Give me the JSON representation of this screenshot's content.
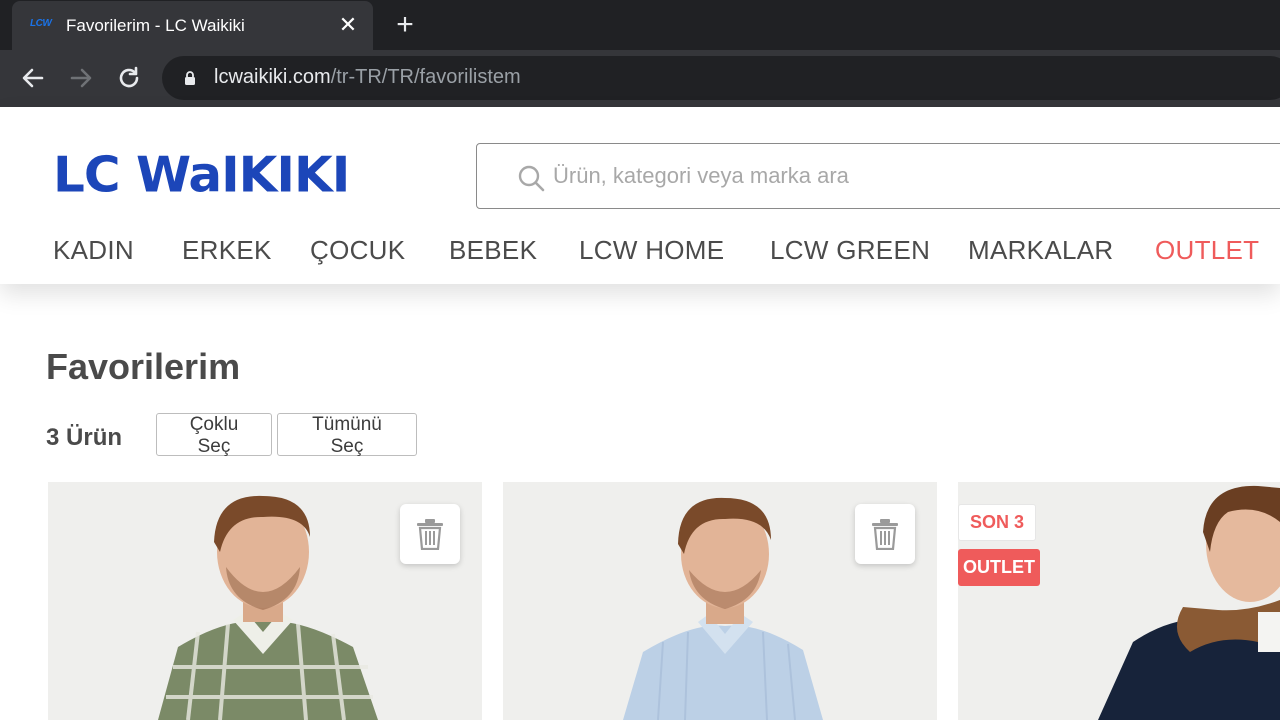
{
  "browser": {
    "tab_favicon": "LCW",
    "tab_title": "Favorilerim - LC Waikiki",
    "close_glyph": "✕",
    "newtab_glyph": "+",
    "url_host": "lcwaikiki.com",
    "url_path": "/tr-TR/TR/favorilistem"
  },
  "header": {
    "logo_text": "LC WaIKIKI",
    "brand_color": "#1c46b9",
    "search_placeholder": "Ürün, kategori veya marka ara",
    "nav": [
      {
        "label": "KADIN"
      },
      {
        "label": "ERKEK"
      },
      {
        "label": "ÇOCUK"
      },
      {
        "label": "BEBEK"
      },
      {
        "label": "LCW HOME"
      },
      {
        "label": "LCW GREEN"
      },
      {
        "label": "MARKALAR"
      },
      {
        "label": "OUTLET",
        "color": "#ef5b5b"
      }
    ]
  },
  "main": {
    "title": "Favorilerim",
    "count_label": "3 Ürün",
    "multi_select_label": "Çoklu Seç",
    "select_all_label": "Tümünü Seç"
  },
  "products": [
    {
      "image": "man-plaid-shirt",
      "action_icon": "trash-icon"
    },
    {
      "image": "man-light-blue-shirt",
      "action_icon": "trash-icon"
    },
    {
      "image": "man-navy-jacket",
      "badges": [
        "SON 3",
        "OUTLET"
      ]
    }
  ],
  "colors": {
    "accent_red": "#ef5b5b",
    "text_dark": "#4a4a4a"
  }
}
